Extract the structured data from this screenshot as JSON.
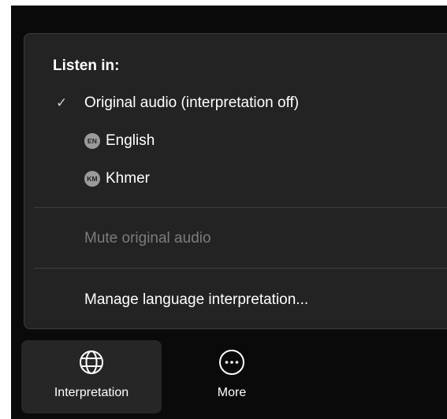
{
  "menu": {
    "section_title": "Listen in:",
    "options": [
      {
        "label": "Original audio (interpretation off)",
        "checked": true
      },
      {
        "badge": "EN",
        "label": "English",
        "checked": false
      },
      {
        "badge": "KM",
        "label": "Khmer",
        "checked": false
      }
    ],
    "mute_label": "Mute original audio",
    "manage_label": "Manage language interpretation..."
  },
  "toolbar": {
    "interpretation_label": "Interpretation",
    "more_label": "More"
  },
  "icons": {
    "check": "check-icon",
    "globe": "globe-icon",
    "more": "more-icon"
  },
  "colors": {
    "menu_bg": "#232323",
    "app_bg": "#0a0a0a",
    "badge_bg": "#9a9a9a",
    "disabled_text": "#7c7c7c"
  }
}
